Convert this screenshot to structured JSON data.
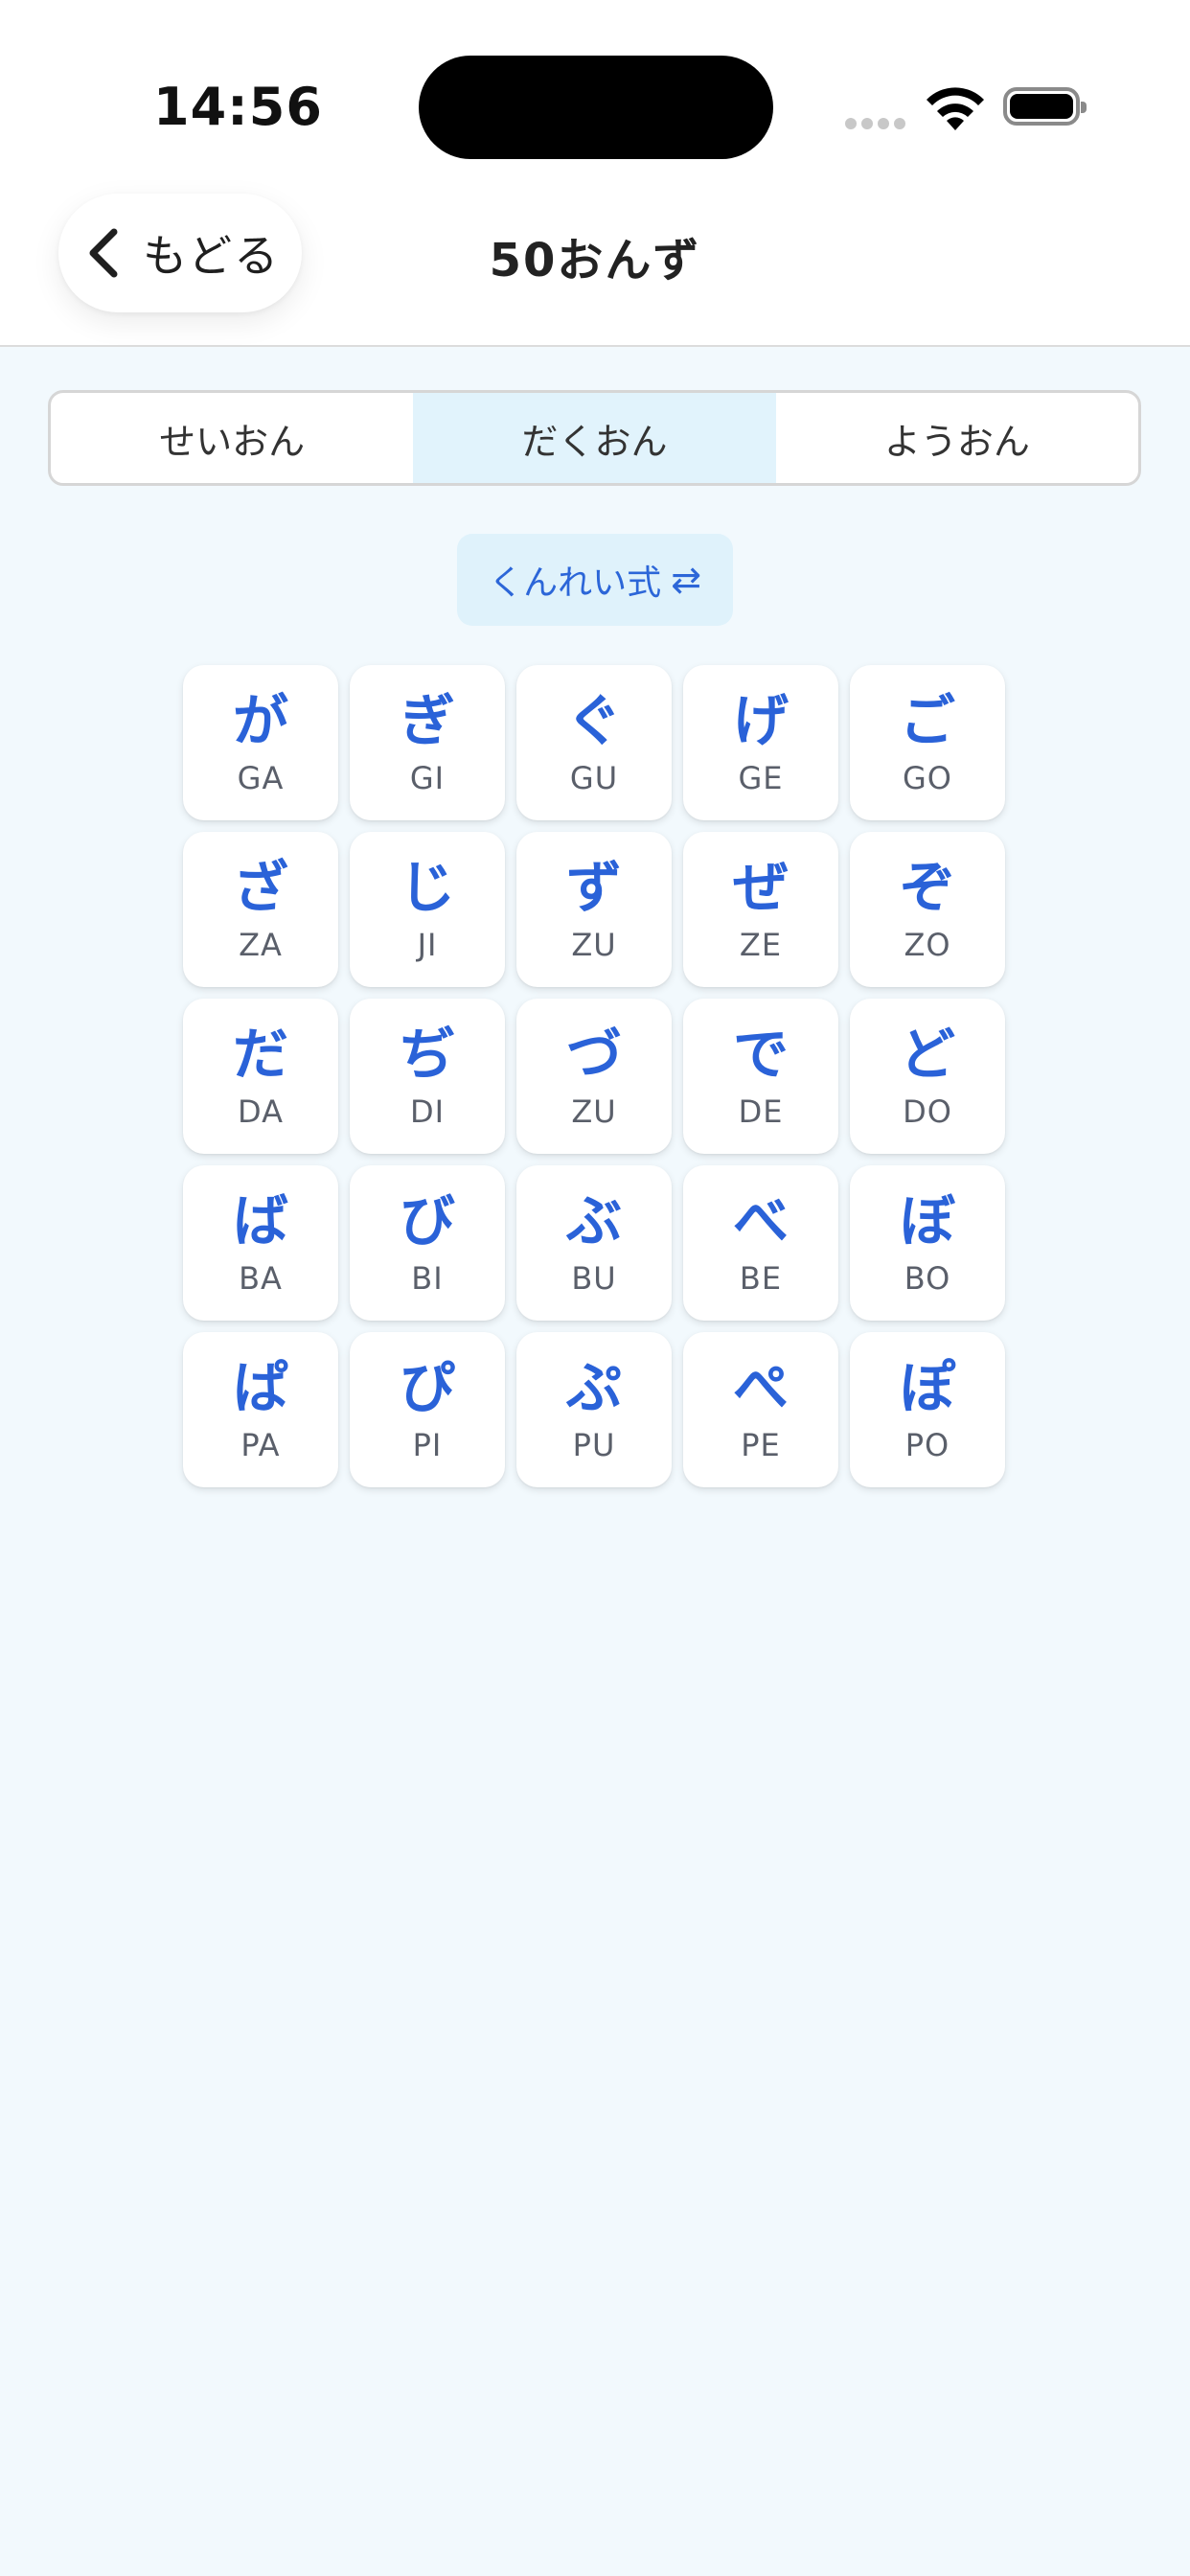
{
  "status": {
    "time": "14:56",
    "icons": [
      "cellular-signal-icon",
      "wifi-icon",
      "battery-icon"
    ]
  },
  "header": {
    "back_label": "もどる",
    "title": "50おんず"
  },
  "tabs": [
    {
      "label": "せいおん",
      "active": false
    },
    {
      "label": "だくおん",
      "active": true
    },
    {
      "label": "ようおん",
      "active": false
    }
  ],
  "romaji_toggle": {
    "label": "くんれい式",
    "icon": "⇄"
  },
  "grid": [
    [
      {
        "kana": "が",
        "romaji": "GA"
      },
      {
        "kana": "ぎ",
        "romaji": "GI"
      },
      {
        "kana": "ぐ",
        "romaji": "GU"
      },
      {
        "kana": "げ",
        "romaji": "GE"
      },
      {
        "kana": "ご",
        "romaji": "GO"
      }
    ],
    [
      {
        "kana": "ざ",
        "romaji": "ZA"
      },
      {
        "kana": "じ",
        "romaji": "JI"
      },
      {
        "kana": "ず",
        "romaji": "ZU"
      },
      {
        "kana": "ぜ",
        "romaji": "ZE"
      },
      {
        "kana": "ぞ",
        "romaji": "ZO"
      }
    ],
    [
      {
        "kana": "だ",
        "romaji": "DA"
      },
      {
        "kana": "ぢ",
        "romaji": "DI"
      },
      {
        "kana": "づ",
        "romaji": "ZU"
      },
      {
        "kana": "で",
        "romaji": "DE"
      },
      {
        "kana": "ど",
        "romaji": "DO"
      }
    ],
    [
      {
        "kana": "ば",
        "romaji": "BA"
      },
      {
        "kana": "び",
        "romaji": "BI"
      },
      {
        "kana": "ぶ",
        "romaji": "BU"
      },
      {
        "kana": "べ",
        "romaji": "BE"
      },
      {
        "kana": "ぼ",
        "romaji": "BO"
      }
    ],
    [
      {
        "kana": "ぱ",
        "romaji": "PA"
      },
      {
        "kana": "ぴ",
        "romaji": "PI"
      },
      {
        "kana": "ぷ",
        "romaji": "PU"
      },
      {
        "kana": "ぺ",
        "romaji": "PE"
      },
      {
        "kana": "ぽ",
        "romaji": "PO"
      }
    ]
  ],
  "colors": {
    "accent": "#2a62d8",
    "background": "#f2f9fd",
    "active_tab": "#e1f3fc"
  }
}
